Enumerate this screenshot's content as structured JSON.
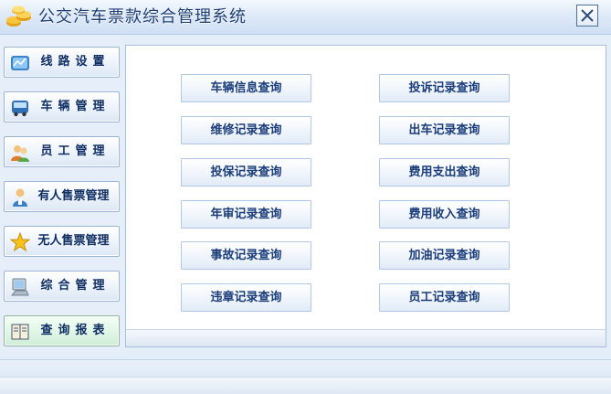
{
  "window": {
    "title": "公交汽车票款综合管理系统",
    "logo_icon": "coins-logo-icon",
    "close_icon": "close-icon"
  },
  "nav": {
    "items": [
      {
        "label": "线路设置",
        "icon": "route-settings-icon"
      },
      {
        "label": "车辆管理",
        "icon": "bus-icon"
      },
      {
        "label": "员工管理",
        "icon": "users-icon"
      },
      {
        "label": "有人售票管理",
        "icon": "ticket-seller-icon"
      },
      {
        "label": "无人售票管理",
        "icon": "star-icon"
      },
      {
        "label": "综合管理",
        "icon": "computer-icon"
      },
      {
        "label": "查询报表",
        "icon": "report-book-icon"
      }
    ],
    "active_index": 6
  },
  "queries": {
    "left": [
      "车辆信息查询",
      "维修记录查询",
      "投保记录查询",
      "年审记录查询",
      "事故记录查询",
      "违章记录查询"
    ],
    "right": [
      "投诉记录查询",
      "出车记录查询",
      "费用支出查询",
      "费用收入查询",
      "加油记录查询",
      "员工记录查询"
    ]
  },
  "colors": {
    "title_text": "#1e3f73",
    "nav_text": "#0f2e63",
    "button_text": "#1b3d7a",
    "active_nav_bg": "#e2f7e7"
  }
}
